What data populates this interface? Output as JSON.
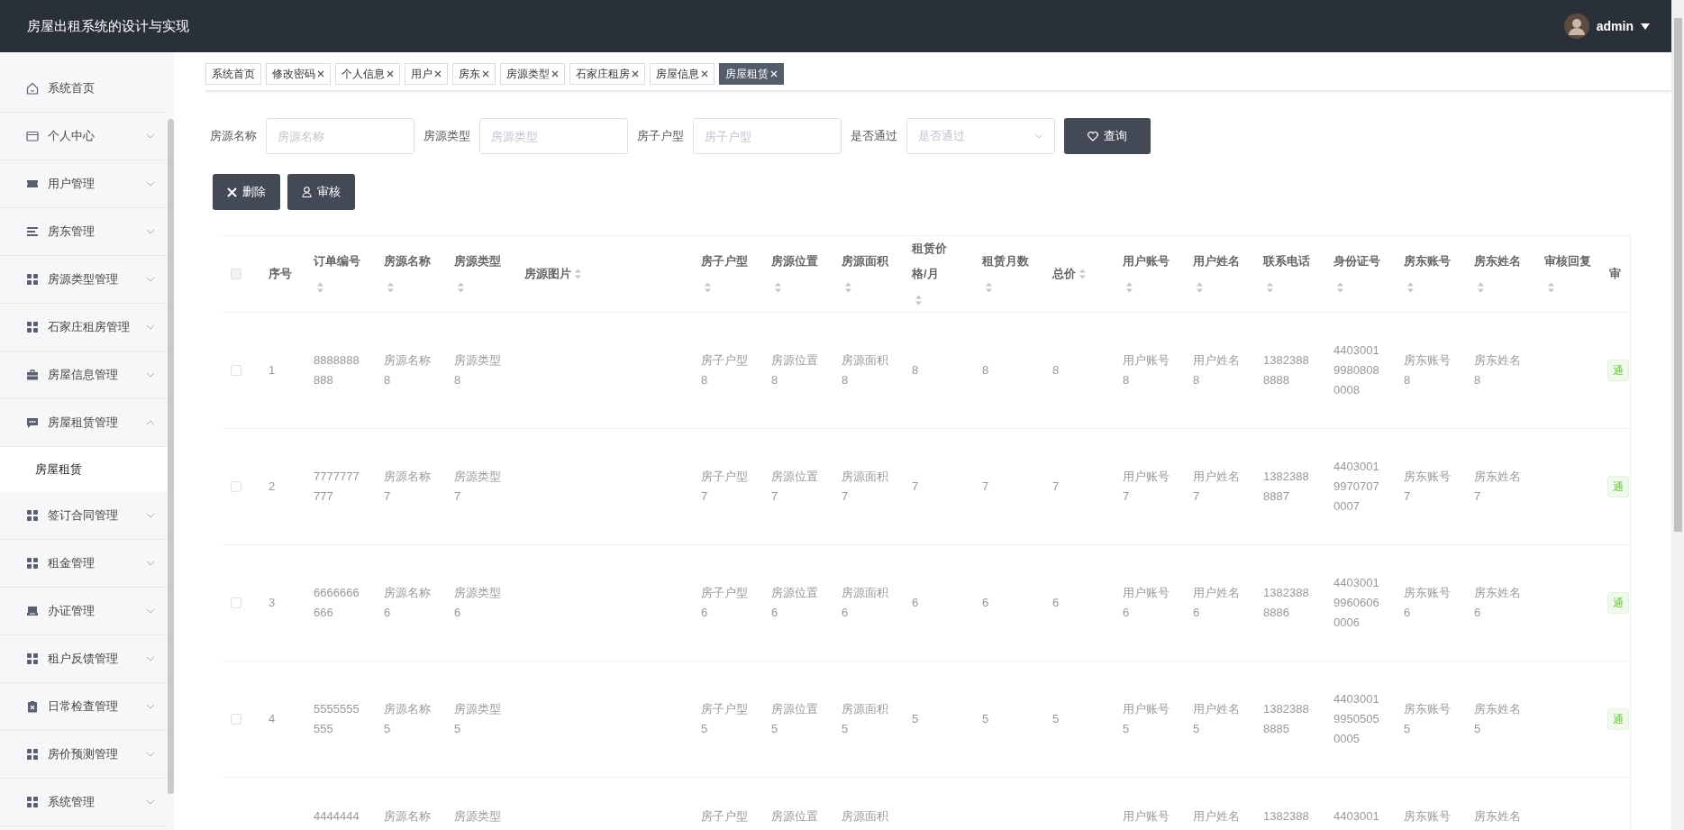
{
  "header": {
    "title": "房屋出租系统的设计与实现",
    "user": {
      "name": "admin"
    }
  },
  "sidebar": {
    "items": [
      {
        "label": "系统首页",
        "kind": "link"
      },
      {
        "label": "个人中心",
        "kind": "menu",
        "expanded": false
      },
      {
        "label": "用户管理",
        "kind": "menu",
        "expanded": false
      },
      {
        "label": "房东管理",
        "kind": "menu",
        "expanded": false
      },
      {
        "label": "房源类型管理",
        "kind": "menu",
        "expanded": false
      },
      {
        "label": "石家庄租房管理",
        "kind": "menu",
        "expanded": false
      },
      {
        "label": "房屋信息管理",
        "kind": "menu",
        "expanded": false
      },
      {
        "label": "房屋租赁管理",
        "kind": "menu",
        "expanded": true,
        "children": [
          {
            "label": "房屋租赁",
            "selected": true
          }
        ]
      },
      {
        "label": "签订合同管理",
        "kind": "menu",
        "expanded": false
      },
      {
        "label": "租金管理",
        "kind": "menu",
        "expanded": false
      },
      {
        "label": "办证管理",
        "kind": "menu",
        "expanded": false
      },
      {
        "label": "租户反馈管理",
        "kind": "menu",
        "expanded": false
      },
      {
        "label": "日常检查管理",
        "kind": "menu",
        "expanded": false
      },
      {
        "label": "房价预测管理",
        "kind": "menu",
        "expanded": false
      },
      {
        "label": "系统管理",
        "kind": "menu",
        "expanded": false
      }
    ]
  },
  "tabs": [
    {
      "label": "系统首页",
      "selected": false,
      "closable": false
    },
    {
      "label": "修改密码",
      "selected": false,
      "closable": true
    },
    {
      "label": "个人信息",
      "selected": false,
      "closable": true
    },
    {
      "label": "用户",
      "selected": false,
      "closable": true
    },
    {
      "label": "房东",
      "selected": false,
      "closable": true
    },
    {
      "label": "房源类型",
      "selected": false,
      "closable": true
    },
    {
      "label": "石家庄租房",
      "selected": false,
      "closable": true
    },
    {
      "label": "房屋信息",
      "selected": false,
      "closable": true
    },
    {
      "label": "房屋租赁",
      "selected": true,
      "closable": true
    }
  ],
  "search": {
    "fields": [
      {
        "label": "房源名称",
        "placeholder": "房源名称",
        "kind": "input"
      },
      {
        "label": "房源类型",
        "placeholder": "房源类型",
        "kind": "input"
      },
      {
        "label": "房子户型",
        "placeholder": "房子户型",
        "kind": "input"
      },
      {
        "label": "是否通过",
        "placeholder": "是否通过",
        "kind": "select"
      }
    ],
    "button": "查询"
  },
  "actions": [
    {
      "label": "删除",
      "kind": "delete"
    },
    {
      "label": "审核",
      "kind": "review"
    }
  ],
  "table": {
    "all_checked": false,
    "columns": [
      {
        "label": "序号",
        "sortable": false
      },
      {
        "label": "订单编号",
        "sortable": true
      },
      {
        "label": "房源名称",
        "sortable": true
      },
      {
        "label": "房源类型",
        "sortable": true
      },
      {
        "label": "房源图片",
        "sortable": true
      },
      {
        "label": "房子户型",
        "sortable": true
      },
      {
        "label": "房源位置",
        "sortable": true
      },
      {
        "label": "房源面积",
        "sortable": true
      },
      {
        "label": "租赁价格/月",
        "sortable": true
      },
      {
        "label": "租赁月数",
        "sortable": true
      },
      {
        "label": "总价",
        "sortable": true
      },
      {
        "label": "用户账号",
        "sortable": true
      },
      {
        "label": "用户姓名",
        "sortable": true
      },
      {
        "label": "联系电话",
        "sortable": true
      },
      {
        "label": "身份证号",
        "sortable": true
      },
      {
        "label": "房东账号",
        "sortable": true
      },
      {
        "label": "房东姓名",
        "sortable": true
      },
      {
        "label": "审核回复",
        "sortable": true
      },
      {
        "label": "审",
        "sortable": false
      }
    ],
    "rows": [
      {
        "checked": false,
        "index": "1",
        "order_no": "8888888888",
        "name": "房源名称8",
        "type": "房源类型8",
        "layout": "房子户型8",
        "location": "房源位置8",
        "area": "房源面积8",
        "price": "8",
        "months": "8",
        "total": "8",
        "user_account": "用户账号8",
        "user_name": "用户姓名8",
        "phone": "13823888888",
        "id_card": "440300199808080008",
        "landlord_account": "房东账号8",
        "landlord_name": "房东姓名8",
        "status": "通"
      },
      {
        "checked": false,
        "index": "2",
        "order_no": "7777777777",
        "name": "房源名称7",
        "type": "房源类型7",
        "layout": "房子户型7",
        "location": "房源位置7",
        "area": "房源面积7",
        "price": "7",
        "months": "7",
        "total": "7",
        "user_account": "用户账号7",
        "user_name": "用户姓名7",
        "phone": "13823888887",
        "id_card": "440300199707070007",
        "landlord_account": "房东账号7",
        "landlord_name": "房东姓名7",
        "status": "通"
      },
      {
        "checked": false,
        "index": "3",
        "order_no": "6666666666",
        "name": "房源名称6",
        "type": "房源类型6",
        "layout": "房子户型6",
        "location": "房源位置6",
        "area": "房源面积6",
        "price": "6",
        "months": "6",
        "total": "6",
        "user_account": "用户账号6",
        "user_name": "用户姓名6",
        "phone": "13823888886",
        "id_card": "440300199606060006",
        "landlord_account": "房东账号6",
        "landlord_name": "房东姓名6",
        "status": "通"
      },
      {
        "checked": false,
        "index": "4",
        "order_no": "5555555555",
        "name": "房源名称5",
        "type": "房源类型5",
        "layout": "房子户型5",
        "location": "房源位置5",
        "area": "房源面积5",
        "price": "5",
        "months": "5",
        "total": "5",
        "user_account": "用户账号5",
        "user_name": "用户姓名5",
        "phone": "13823888885",
        "id_card": "440300199505050005",
        "landlord_account": "房东账号5",
        "landlord_name": "房东姓名5",
        "status": "通"
      },
      {
        "order_no": "4444444",
        "name": "房源名称",
        "type": "房源类型",
        "layout": "房子户型",
        "location": "房源位置",
        "area": "房源面积",
        "user_account": "用户账号",
        "user_name": "用户姓名",
        "phone": "1382388",
        "id_card": "4403001",
        "landlord_account": "房东账号",
        "landlord_name": "房东姓名"
      }
    ]
  }
}
